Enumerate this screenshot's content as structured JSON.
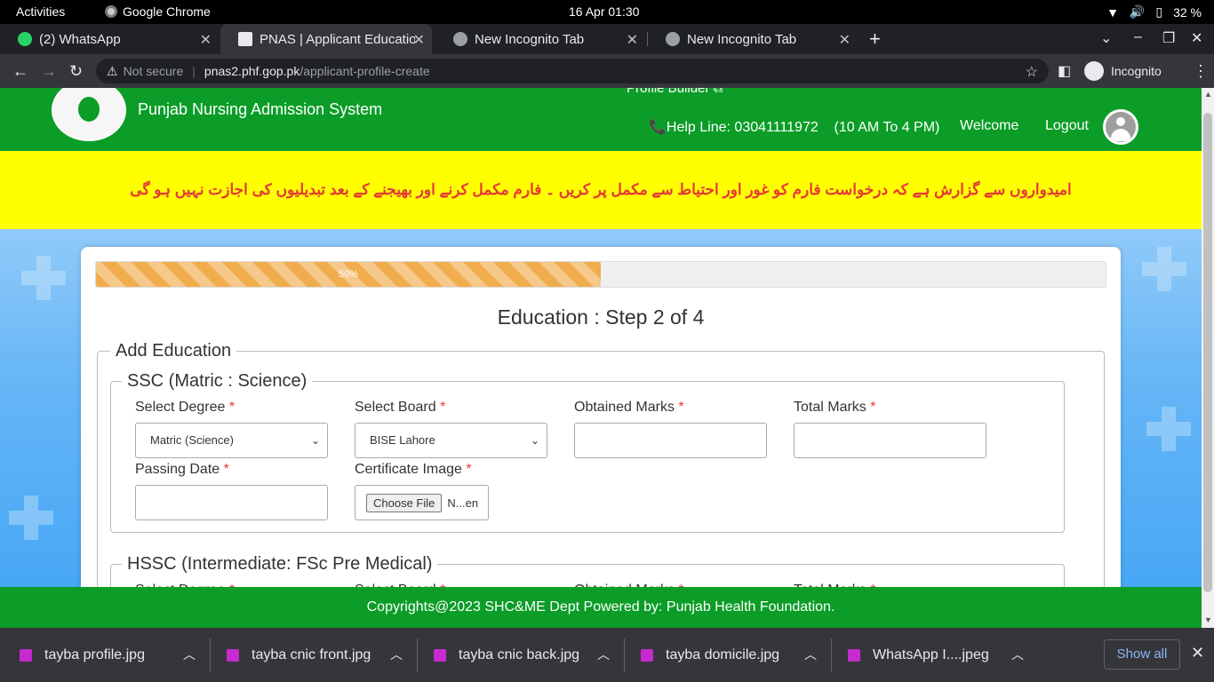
{
  "os": {
    "activities": "Activities",
    "app_name": "Google Chrome",
    "clock": "16 Apr  01:30",
    "battery": "32 %"
  },
  "tabs": [
    {
      "label": "(2) WhatsApp"
    },
    {
      "label": "PNAS | Applicant Educatio"
    },
    {
      "label": "New Incognito Tab"
    },
    {
      "label": "New Incognito Tab"
    }
  ],
  "address": {
    "security": "Not secure",
    "host": "pnas2.phf.gop.pk",
    "path": "/applicant-profile-create",
    "profile": "Incognito"
  },
  "header": {
    "site_title": "Punjab Nursing Admission System",
    "profile_builder": "Profile Builder ⧉",
    "helpline": "📞Help Line: 03041111972    (10 AM To 4 PM)",
    "welcome": "Welcome",
    "logout": "Logout"
  },
  "notice": "امیدواروں سے گزارش ہے کہ درخواست فارم کو غور اور احتیاط سے مکمل پر کریں ۔ فارم مکمل کرنے اور بھیجنے کے بعد تبدیلیوں کی اجازت نہیں ہو گی",
  "progress": {
    "percent": 50,
    "label": "50%"
  },
  "form": {
    "step_title": "Education : Step 2 of 4",
    "section_title": "Add Education",
    "ssc": {
      "legend": "SSC (Matric : Science)",
      "degree_label": "Select Degree",
      "degree_value": "Matric (Science)",
      "board_label": "Select Board",
      "board_value": "BISE Lahore",
      "obtained_label": "Obtained Marks",
      "total_label": "Total Marks",
      "passing_label": "Passing Date",
      "certificate_label": "Certificate Image",
      "choose_file": "Choose File",
      "file_status": "N...en"
    },
    "hssc": {
      "legend": "HSSC (Intermediate: FSc Pre Medical)",
      "degree_label": "Select Degree",
      "board_label": "Select Board",
      "obtained_label": "Obtained Marks",
      "total_label": "Total Marks"
    },
    "required_mark": "*"
  },
  "footer": "Copyrights@2023 SHC&ME Dept Powered by: Punjab Health Foundation.",
  "downloads": {
    "items": [
      {
        "name": "tayba profile.jpg"
      },
      {
        "name": "tayba cnic front.jpg"
      },
      {
        "name": "tayba cnic back.jpg"
      },
      {
        "name": "tayba domicile.jpg"
      },
      {
        "name": "WhatsApp I....jpeg"
      }
    ],
    "show_all": "Show all"
  },
  "colors": {
    "header_green": "#0b9d27",
    "notice_yellow": "#ffff00",
    "notice_red": "#e53935",
    "progress_orange": "#f0ad4e"
  }
}
